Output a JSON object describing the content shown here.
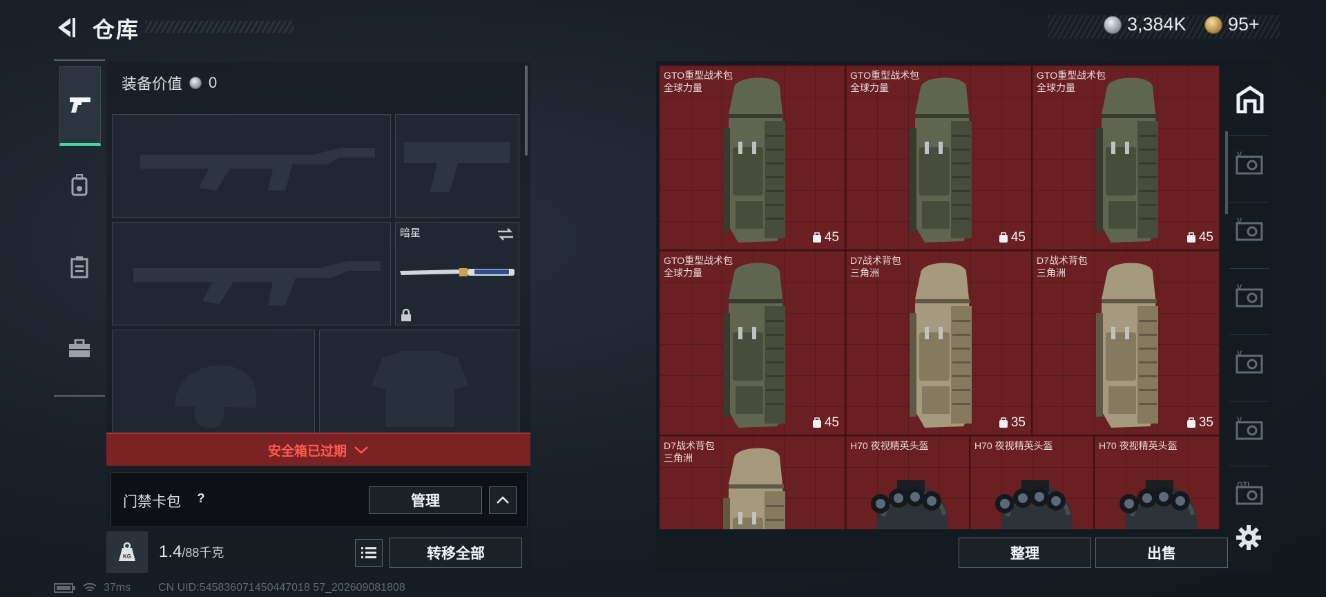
{
  "header": {
    "title": "仓库",
    "currency": [
      {
        "icon": "silver-coin-icon",
        "value": "3,384K"
      },
      {
        "icon": "gold-coin-icon",
        "value": "95+"
      }
    ]
  },
  "sidebar_left": {
    "tabs": [
      {
        "name": "weapons",
        "icon": "pistol-icon",
        "active": true
      },
      {
        "name": "gear",
        "icon": "backpack-icon",
        "active": false
      },
      {
        "name": "consumables",
        "icon": "clipboard-icon",
        "active": false
      },
      {
        "name": "supplies",
        "icon": "toolbox-icon",
        "active": false
      }
    ]
  },
  "equipment": {
    "value_label": "装备价值",
    "value": "0",
    "melee": {
      "name": "暗星",
      "locked": true
    }
  },
  "safebox": {
    "label": "安全箱已过期"
  },
  "card_pack": {
    "label": "门禁卡包",
    "help": "?",
    "manage_label": "管理"
  },
  "weight": {
    "current": "1.4",
    "max": "/88千克",
    "kg_icon_text": "KG"
  },
  "transfer_label": "转移全部",
  "status": {
    "ping": "37ms",
    "uid": "CN UID:545836071450447018 57_202609081808"
  },
  "inventory": {
    "items": [
      {
        "name": "GTO重型战术包",
        "brand": "全球力量",
        "capacity": "45",
        "kind": "backpack-green"
      },
      {
        "name": "GTO重型战术包",
        "brand": "全球力量",
        "capacity": "45",
        "kind": "backpack-green"
      },
      {
        "name": "GTO重型战术包",
        "brand": "全球力量",
        "capacity": "45",
        "kind": "backpack-green"
      },
      {
        "name": "GTO重型战术包",
        "brand": "全球力量",
        "capacity": "45",
        "kind": "backpack-green"
      },
      {
        "name": "D7战术背包",
        "brand": "三角洲",
        "capacity": "35",
        "kind": "backpack-tan"
      },
      {
        "name": "D7战术背包",
        "brand": "三角洲",
        "capacity": "35",
        "kind": "backpack-tan"
      },
      {
        "name": "D7战术背包",
        "brand": "三角洲",
        "capacity": "",
        "kind": "backpack-tan"
      },
      {
        "name": "H70 夜视精英头盔",
        "brand": "",
        "capacity": "",
        "kind": "helmet"
      },
      {
        "name": "H70 夜视精英头盔",
        "brand": "",
        "capacity": "",
        "kind": "helmet"
      },
      {
        "name": "H70 夜视精英头盔",
        "brand": "",
        "capacity": "",
        "kind": "helmet"
      }
    ],
    "sort_label": "整理",
    "sell_label": "出售"
  },
  "sidebar_right": {
    "tabs": [
      {
        "icon": "storage-home-icon",
        "active": true
      },
      {
        "icon": "vault-box-icon",
        "active": false
      },
      {
        "icon": "vault-box-icon",
        "active": false
      },
      {
        "icon": "vault-box-icon",
        "active": false
      },
      {
        "icon": "vault-box-icon",
        "active": false
      },
      {
        "icon": "vault-box-icon",
        "active": false
      },
      {
        "icon": "gti-box-icon",
        "active": false
      }
    ],
    "settings_icon": "gear-icon"
  }
}
